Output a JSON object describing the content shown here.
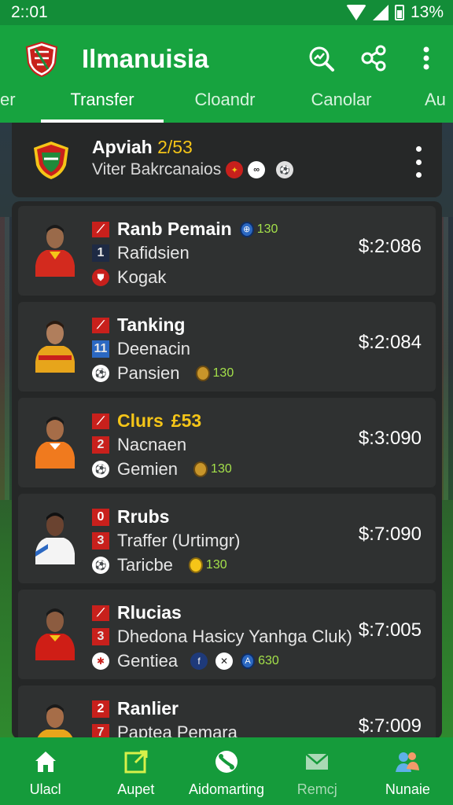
{
  "status_bar": {
    "time": "2::01",
    "battery": "13%"
  },
  "app": {
    "title": "Ilmanuisia"
  },
  "tabs": [
    {
      "label": "er"
    },
    {
      "label": "Transfer"
    },
    {
      "label": "Cloandr"
    },
    {
      "label": "Canolar"
    },
    {
      "label": "Au"
    }
  ],
  "header": {
    "title": "Apviah",
    "title_value": "2/53",
    "subtitle": "Viter Bakrcanaios"
  },
  "players": [
    {
      "name": "Ranb Pemain",
      "name_color": "#ffffff",
      "rating": "130",
      "number": "1",
      "position": "Rafidsien",
      "club": "Kogak",
      "price": "$:2:086",
      "kit": "#d32a1e"
    },
    {
      "name": "Tanking",
      "name_color": "#ffffff",
      "number": "11",
      "position": "Deenacin",
      "club": "Pansien",
      "rating": "130",
      "price": "$:2:084",
      "kit": "#e7a51b"
    },
    {
      "name": "Clurs",
      "name_extra": "£53",
      "name_color": "#f5c518",
      "number": "2",
      "position": "Nacnaen",
      "club": "Gemien",
      "rating": "130",
      "price": "$:3:090",
      "kit": "#f07a1e"
    },
    {
      "name": "Rrubs",
      "name_color": "#ffffff",
      "badge": "0",
      "number": "3",
      "position": "Traffer (Urtimgr)",
      "club": "Taricbe",
      "rating": "130",
      "price": "$:7:090",
      "kit": "#ffffff"
    },
    {
      "name": "Rlucias",
      "name_color": "#ffffff",
      "number": "3",
      "position": "Dhedona Hasicy Yanhga Cluk)",
      "club": "Gentiea",
      "rating": "630",
      "price": "$:7:005",
      "kit": "#cf1e16"
    },
    {
      "name": "Ranlier",
      "name_color": "#ffffff",
      "badge": "2",
      "number": "7",
      "position": "Paptea Pemara",
      "price": "$:7:009",
      "kit": "#e7a51b"
    }
  ],
  "bottom_nav": [
    {
      "label": "Ulacl",
      "icon": "home-icon"
    },
    {
      "label": "Aupet",
      "icon": "edit-icon"
    },
    {
      "label": "Aidomarting",
      "icon": "football-icon"
    },
    {
      "label": "Remcj",
      "icon": "mail-icon"
    },
    {
      "label": "Nunaie",
      "icon": "people-icon"
    }
  ],
  "colors": {
    "primary": "#17a33f",
    "status": "#138d38",
    "nav": "#159b3b",
    "card": "#2f3131",
    "accent": "#f5c518",
    "rating": "#a4e04a"
  }
}
